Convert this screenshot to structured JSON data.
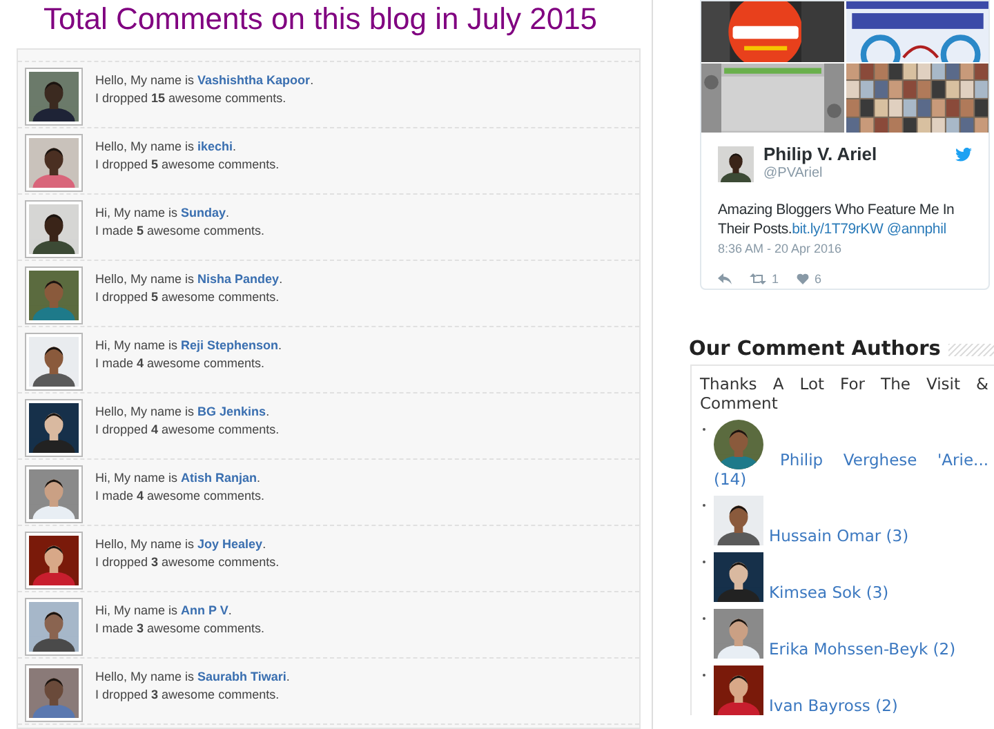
{
  "page_title": "Total Comments on this blog in July 2015",
  "commenters": [
    {
      "intro": "Hello, My name is",
      "name": "Vashishtha Kapoor",
      "end": ".",
      "tally": "I dropped **15** awesome comments."
    },
    {
      "intro": "Hello, My name is",
      "name": "ikechi",
      "end": ".",
      "tally": "I dropped **5** awesome comments."
    },
    {
      "intro": "Hi, My name is",
      "name": "Sunday",
      "end": ".",
      "tally": "I made **5** awesome comments."
    },
    {
      "intro": "Hello, My name is",
      "name": "Nisha Pandey",
      "end": ".",
      "tally": "I dropped **5** awesome comments."
    },
    {
      "intro": "Hi, My name is",
      "name": "Reji Stephenson",
      "end": ".",
      "tally": "I made **4** awesome comments."
    },
    {
      "intro": "Hello, My name is",
      "name": "BG Jenkins",
      "end": ".",
      "tally": "I dropped **4** awesome comments."
    },
    {
      "intro": "Hi, My name is",
      "name": "Atish Ranjan",
      "end": ".",
      "tally": "I made **4** awesome comments."
    },
    {
      "intro": "Hello, My name is",
      "name": "Joy Healey",
      "end": ".",
      "tally": "I dropped **3** awesome comments."
    },
    {
      "intro": "Hi, My name is",
      "name": "Ann P V",
      "end": ".",
      "tally": "I made **3** awesome comments."
    },
    {
      "intro": "Hello, My name is",
      "name": "Saurabh Tiwari",
      "end": ".",
      "tally": "I dropped **3** awesome comments."
    }
  ],
  "tweet": {
    "author": "Philip V. Ariel",
    "handle": "@PVAriel",
    "text": "Amazing Bloggers Who Feature Me In Their Posts.",
    "link": "bit.ly/1T79rKW",
    "mention": "@annphil",
    "time": "8:36 AM - 20 Apr 2016",
    "retweets": "1",
    "likes": "6"
  },
  "authors_widget": {
    "title": "Our Comment Authors",
    "intro": "Thanks A Lot For The Visit & Comment",
    "authors": [
      {
        "label": "Philip Verghese 'Arie... (14)",
        "kind": "round"
      },
      {
        "label": "Hussain Omar (3)",
        "kind": "square"
      },
      {
        "label": "Kimsea Sok (3)",
        "kind": "square"
      },
      {
        "label": "Erika Mohssen-Beyk (2)",
        "kind": "square"
      },
      {
        "label": "Ivan Bayross (2)",
        "kind": "square"
      }
    ]
  }
}
